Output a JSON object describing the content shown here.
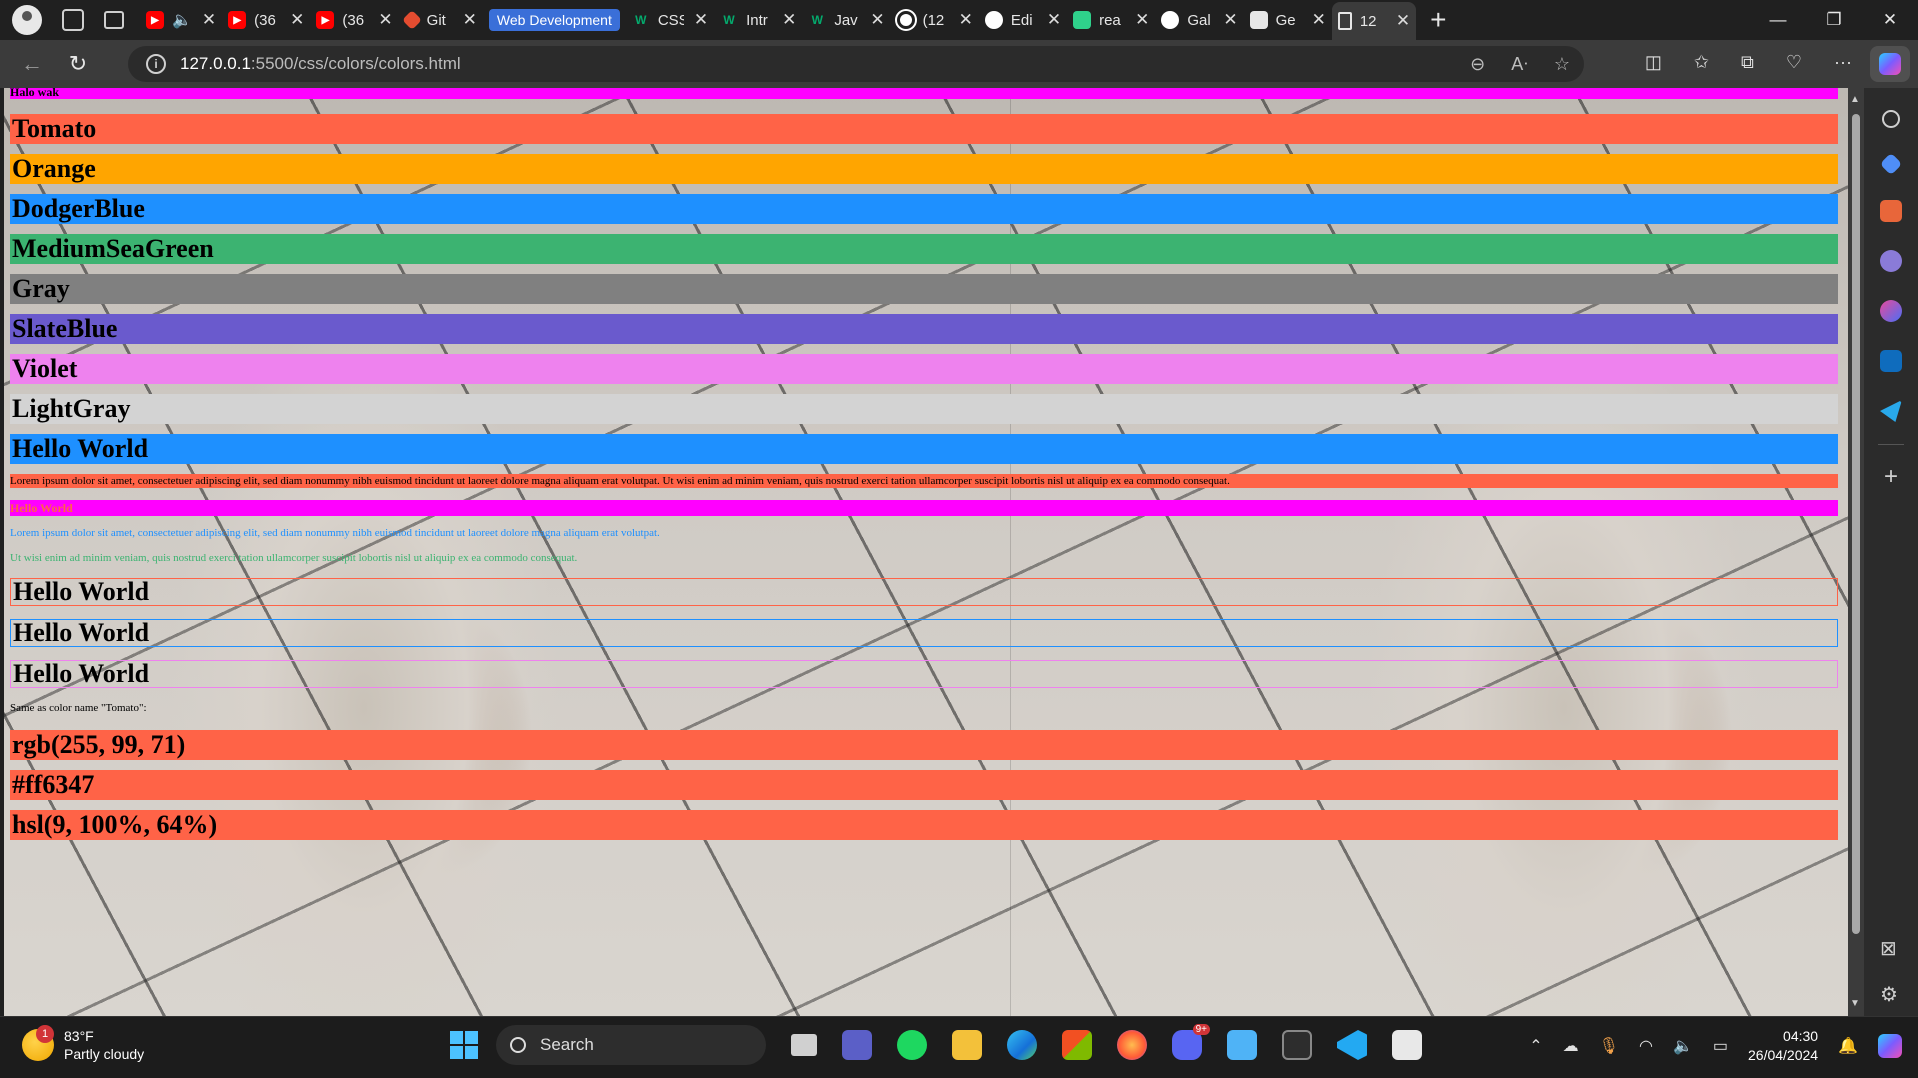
{
  "browser": {
    "tabs": [
      {
        "title": "",
        "favicon": "youtube-icon",
        "color": "#ff0000",
        "extra": "speaker-icon"
      },
      {
        "title": "(36",
        "favicon": "youtube-icon",
        "color": "#ff0000"
      },
      {
        "title": "(36",
        "favicon": "youtube-icon",
        "color": "#ff0000"
      },
      {
        "title": "Git",
        "favicon": "git-icon",
        "color": "#e44c30"
      },
      {
        "title": "CSS",
        "favicon": "w3schools-icon",
        "color": "#04aa6d"
      },
      {
        "title": "Intr",
        "favicon": "w3schools-icon",
        "color": "#04aa6d"
      },
      {
        "title": "Jav",
        "favicon": "w3schools-icon",
        "color": "#04aa6d"
      },
      {
        "title": "(12",
        "favicon": "whatsapp-icon",
        "color": "#25d366"
      },
      {
        "title": "Edi",
        "favicon": "github-icon",
        "color": "#ffffff"
      },
      {
        "title": "rea",
        "favicon": "app-icon",
        "color": "#2fd18b"
      },
      {
        "title": "Gal",
        "favicon": "github-icon",
        "color": "#ffffff"
      },
      {
        "title": "Ge",
        "favicon": "doc-icon",
        "color": "#d8d8d8"
      },
      {
        "title": "12",
        "favicon": "page-icon",
        "color": "#d8d8d8"
      }
    ],
    "tab_group_label": "Web Development",
    "url_host": "127.0.0.1",
    "url_path": ":5500/css/colors/colors.html"
  },
  "page": {
    "headings": [
      {
        "text": "Halo wak",
        "bg": "#ff00ff",
        "size": "small"
      },
      {
        "text": "Tomato",
        "bg": "#ff6347"
      },
      {
        "text": "Orange",
        "bg": "#ffa500"
      },
      {
        "text": "DodgerBlue",
        "bg": "#1e90ff"
      },
      {
        "text": "MediumSeaGreen",
        "bg": "#3cb371"
      },
      {
        "text": "Gray",
        "bg": "#808080"
      },
      {
        "text": "SlateBlue",
        "bg": "#6a5acd"
      },
      {
        "text": "Violet",
        "bg": "#ee82ee"
      },
      {
        "text": "LightGray",
        "bg": "#d3d3d3"
      },
      {
        "text": "Hello World",
        "bg": "#1e90ff"
      }
    ],
    "para_tomato": "Lorem ipsum dolor sit amet, consectetuer adipiscing elit, sed diam nonummy nibh euismod tincidunt ut laoreet dolore magna aliquam erat volutpat. Ut wisi enim ad minim veniam, quis nostrud exerci tation ullamcorper suscipit lobortis nisl ut aliquip ex ea commodo consequat.",
    "hello_tomato_text": "Hello World",
    "para_dodger": "Lorem ipsum dolor sit amet, consectetuer adipiscing elit, sed diam nonummy nibh euismod tincidunt ut laoreet dolore magna aliquam erat volutpat.",
    "para_green": "Ut wisi enim ad minim veniam, quis nostrud exerci tation ullamcorper suscipit lobortis nisl ut aliquip ex ea commodo consequat.",
    "bordered": [
      {
        "text": "Hello World",
        "border": "#ff6347"
      },
      {
        "text": "Hello World",
        "border": "#1e90ff"
      },
      {
        "text": "Hello World",
        "border": "#ee82ee"
      }
    ],
    "same_as_text": "Same as color name \"Tomato\":",
    "values": [
      {
        "text": "rgb(255, 99, 71)",
        "bg": "#ff6347"
      },
      {
        "text": "#ff6347",
        "bg": "#ff6347"
      },
      {
        "text": "hsl(9, 100%, 64%)",
        "bg": "#ff6347"
      }
    ]
  },
  "taskbar": {
    "weather_temp": "83°F",
    "weather_desc": "Partly cloudy",
    "weather_badge": "1",
    "search_placeholder": "Search",
    "time": "04:30",
    "date": "26/04/2024",
    "discord_badge": "9+"
  },
  "colors": {
    "accent": "#3a6fd8",
    "tomato": "#ff6347",
    "magenta": "#ff00ff"
  }
}
